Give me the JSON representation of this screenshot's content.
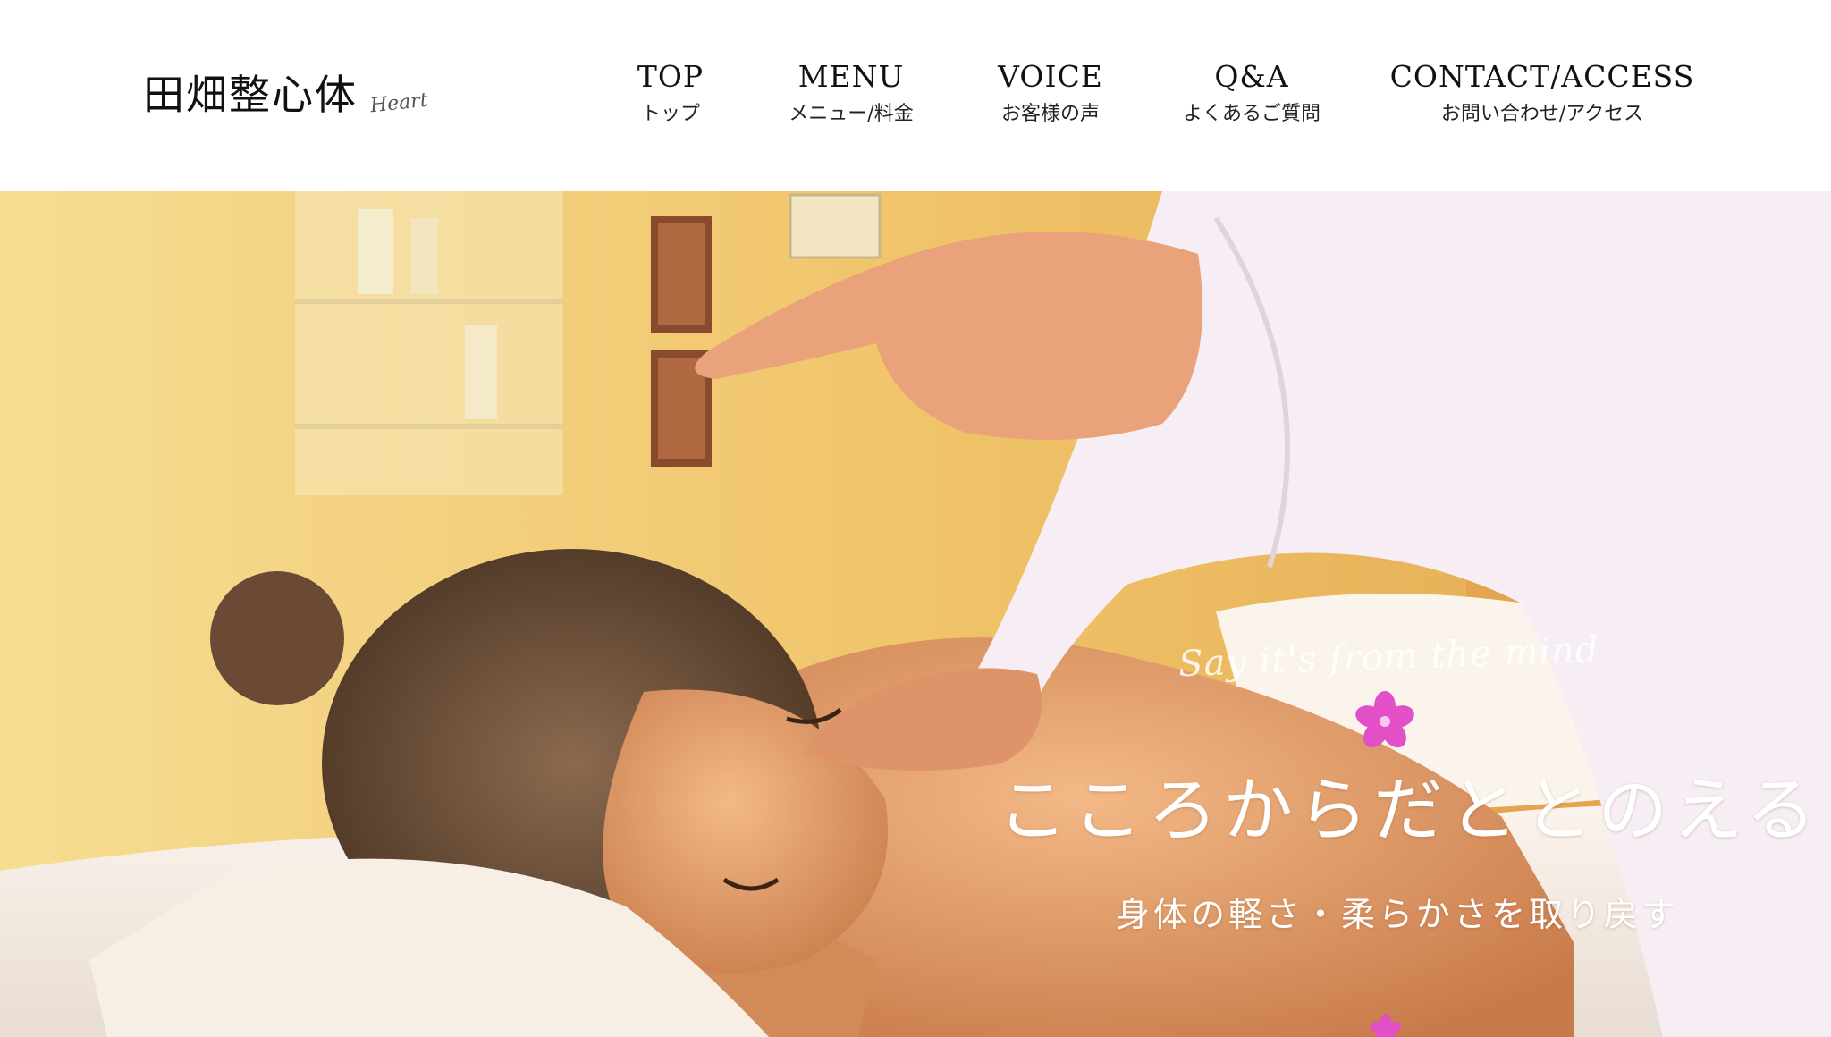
{
  "brand": {
    "name": "田畑整心体",
    "script": "Heart"
  },
  "nav": {
    "items": [
      {
        "en": "TOP",
        "ja": "トップ"
      },
      {
        "en": "MENU",
        "ja": "メニュー/料金"
      },
      {
        "en": "VOICE",
        "ja": "お客様の声"
      },
      {
        "en": "Q&A",
        "ja": "よくあるご質問"
      },
      {
        "en": "CONTACT/ACCESS",
        "ja": "お問い合わせ/アクセス"
      }
    ]
  },
  "hero": {
    "script_tagline": "Say it's from the mind",
    "title": "こころからだととのえる",
    "subtitle": "身体の軽さ・柔らかさを取り戻す"
  },
  "colors": {
    "accent_flower": "#e34fc6",
    "text_dark": "#111111",
    "hero_text": "#ffffff"
  }
}
